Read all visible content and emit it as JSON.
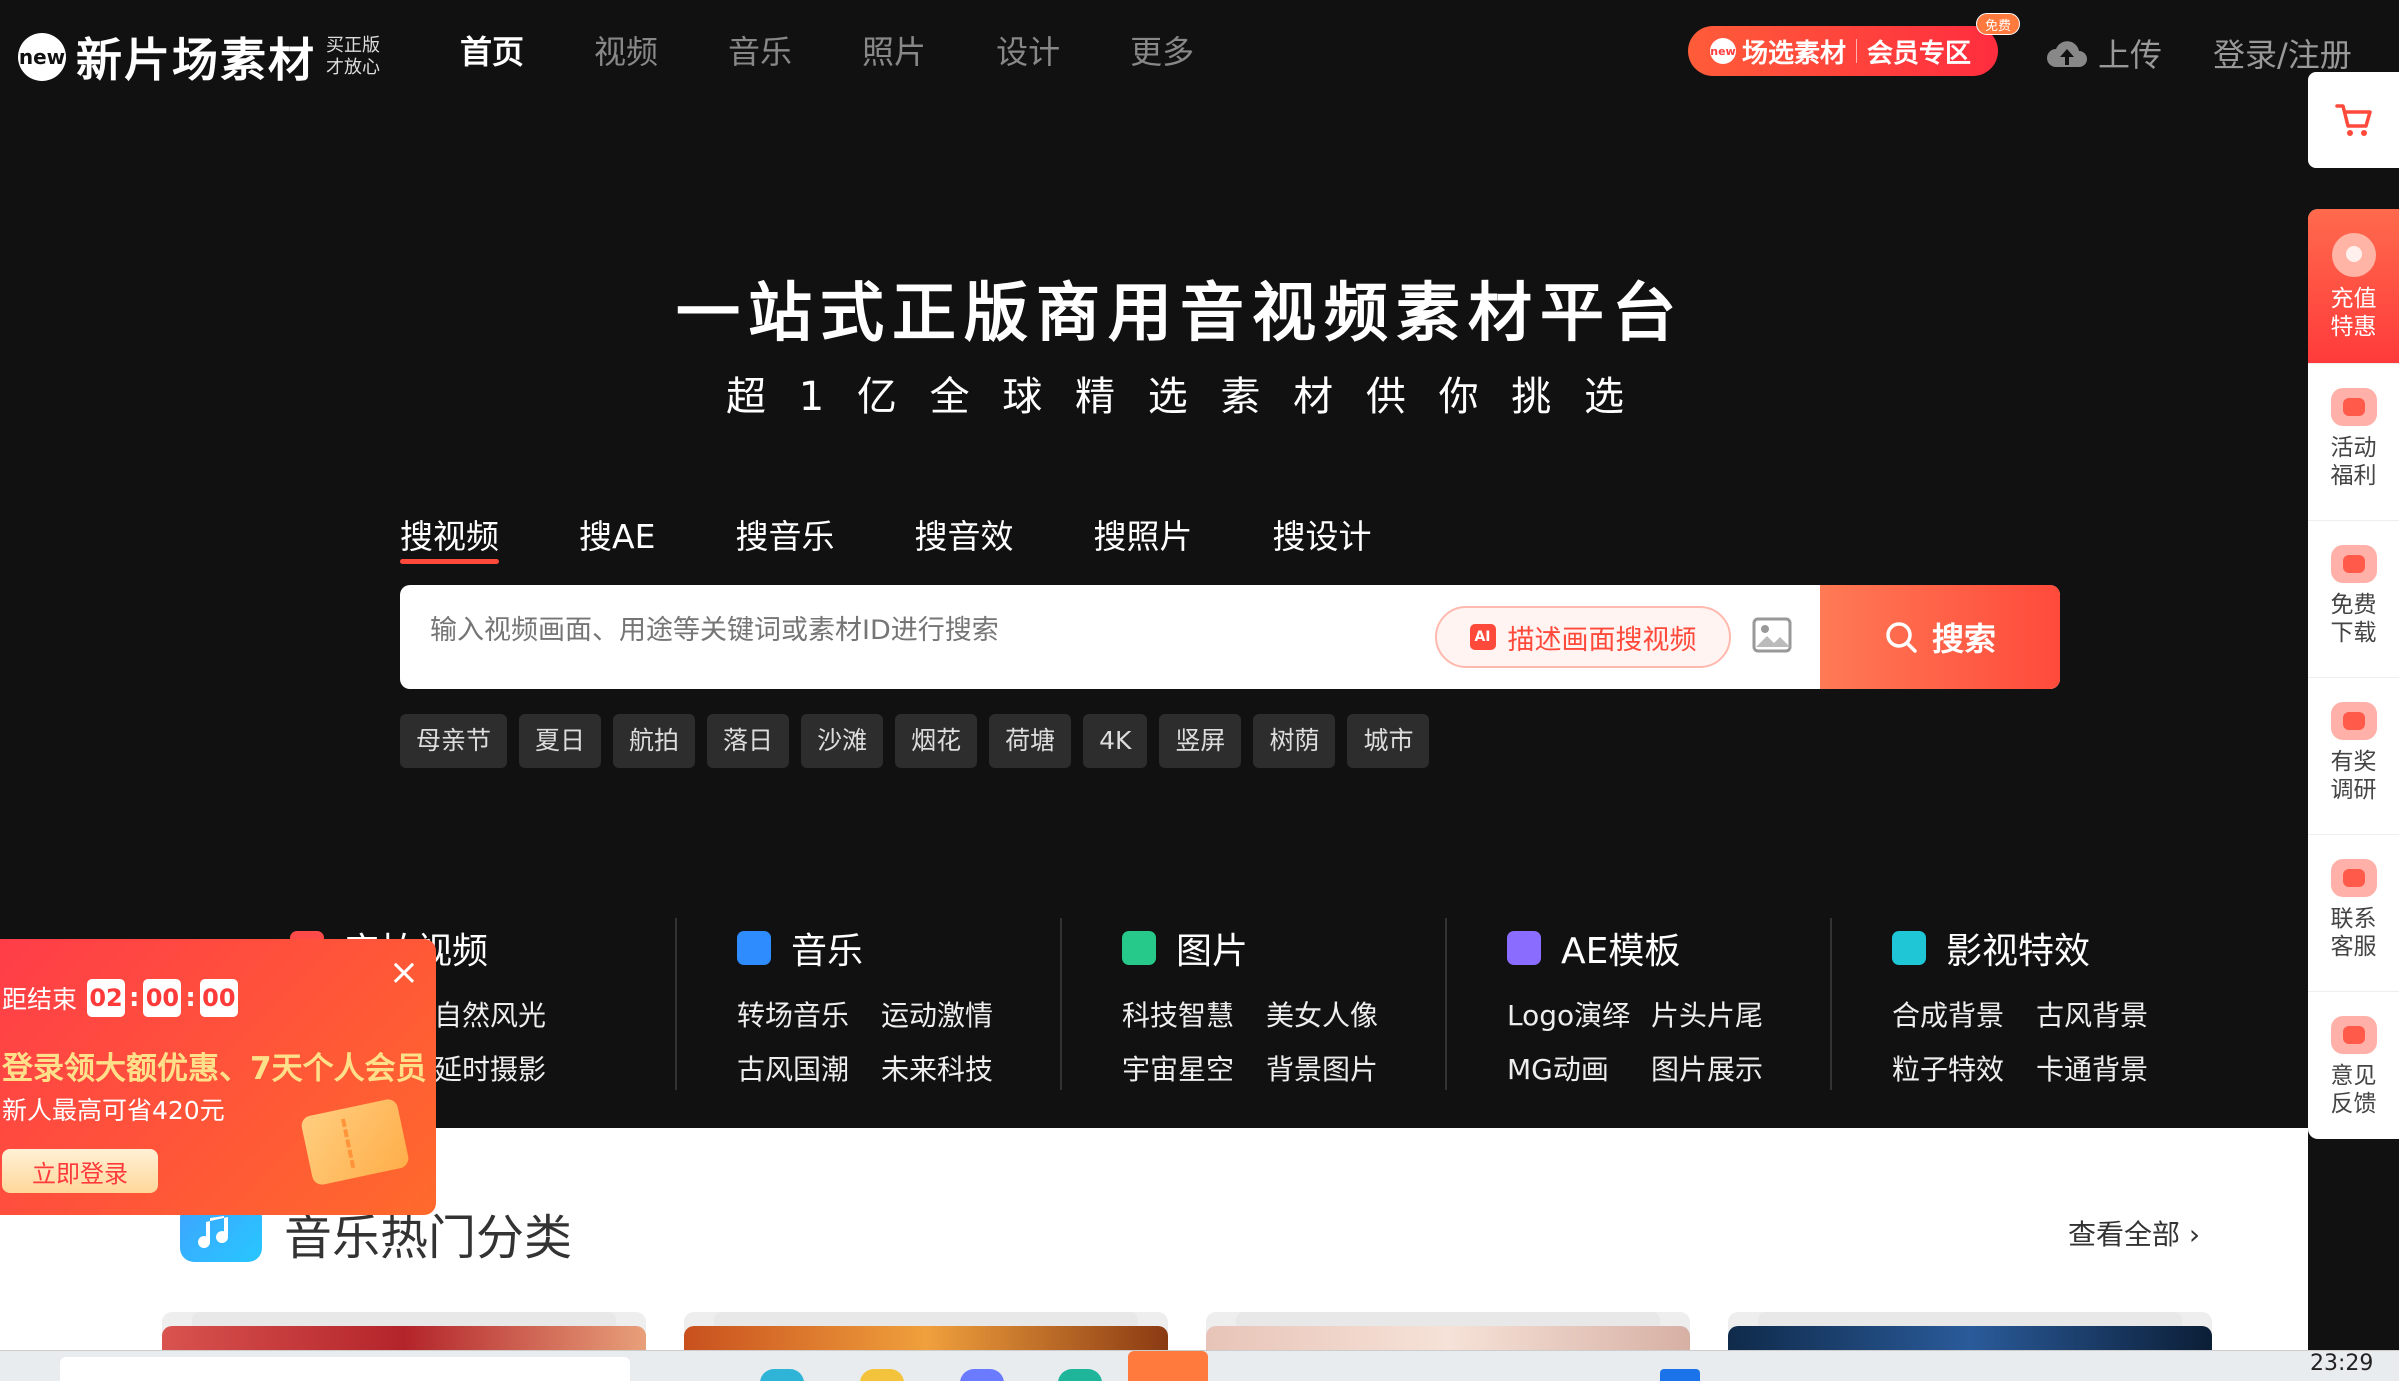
{
  "header": {
    "logo_badge": "new",
    "logo_name": "新片场素材",
    "logo_slogan": "买正版才放心",
    "nav": [
      "首页",
      "视频",
      "音乐",
      "照片",
      "设计",
      "更多"
    ],
    "promo_new": "new",
    "promo_left": "场选素材",
    "promo_right": "会员专区",
    "promo_free_tag": "免费",
    "upload_label": "上传",
    "login_label": "登录/注册"
  },
  "sidebar": {
    "items": [
      {
        "label": "充值特惠",
        "icon": "gift-icon"
      },
      {
        "label": "活动福利",
        "icon": "ticket-icon"
      },
      {
        "label": "免费下载",
        "icon": "download-icon"
      },
      {
        "label": "有奖调研",
        "icon": "survey-icon"
      },
      {
        "label": "联系客服",
        "icon": "headset-icon"
      },
      {
        "label": "意见反馈",
        "icon": "mail-icon"
      }
    ]
  },
  "hero": {
    "title": "一站式正版商用音视频素材平台",
    "subtitle": "超 1 亿 全 球 精 选 素 材 供 你 挑 选"
  },
  "search": {
    "tabs": [
      "搜视频",
      "搜AE",
      "搜音乐",
      "搜音效",
      "搜照片",
      "搜设计"
    ],
    "placeholder": "输入视频画面、用途等关键词或素材ID进行搜索",
    "ai_icon": "AI",
    "ai_button": "描述画面搜视频",
    "submit": "搜索",
    "hot_tags": [
      "母亲节",
      "夏日",
      "航拍",
      "落日",
      "沙滩",
      "烟花",
      "荷塘",
      "4K",
      "竖屏",
      "树荫",
      "城市"
    ]
  },
  "categories": [
    {
      "title": "实拍视频",
      "color": "#ff4a4a",
      "links": [
        "",
        "自然风光",
        "",
        "延时摄影"
      ]
    },
    {
      "title": "音乐",
      "color": "#2f8cff",
      "links": [
        "转场音乐",
        "运动激情",
        "古风国潮",
        "未来科技"
      ]
    },
    {
      "title": "图片",
      "color": "#27c98a",
      "links": [
        "科技智慧",
        "美女人像",
        "宇宙星空",
        "背景图片"
      ]
    },
    {
      "title": "AE模板",
      "color": "#8a6cff",
      "links": [
        "Logo演绎",
        "片头片尾",
        "MG动画",
        "图片展示"
      ]
    },
    {
      "title": "影视特效",
      "color": "#1fc6d6",
      "links": [
        "合成背景",
        "古风背景",
        "粒子特效",
        "卡通背景"
      ]
    }
  ],
  "music_section": {
    "title": "音乐热门分类",
    "view_all": "查看全部 ›"
  },
  "popup": {
    "countdown_label": "距结束",
    "hours": "02",
    "minutes": "00",
    "seconds": "00",
    "title": "登录领大额优惠、7天个人会员",
    "subtitle": "新人最高可省420元",
    "button": "立即登录",
    "close": "×"
  },
  "taskbar": {
    "time": "23:29"
  }
}
